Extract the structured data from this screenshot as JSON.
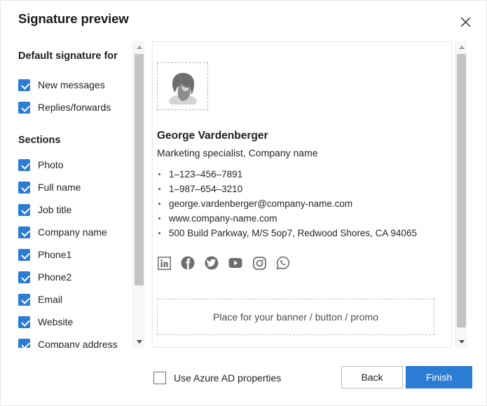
{
  "dialog": {
    "title": "Signature preview",
    "close_icon": "close-icon"
  },
  "sidebar": {
    "groups": [
      {
        "title": "Default signature for",
        "items": [
          {
            "label": "New messages",
            "checked": true
          },
          {
            "label": "Replies/forwards",
            "checked": true
          }
        ]
      },
      {
        "title": "Sections",
        "items": [
          {
            "label": "Photo",
            "checked": true
          },
          {
            "label": "Full name",
            "checked": true
          },
          {
            "label": "Job title",
            "checked": true
          },
          {
            "label": "Company name",
            "checked": true
          },
          {
            "label": "Phone1",
            "checked": true
          },
          {
            "label": "Phone2",
            "checked": true
          },
          {
            "label": "Email",
            "checked": true
          },
          {
            "label": "Website",
            "checked": true
          },
          {
            "label": "Company address",
            "checked": true
          }
        ]
      }
    ],
    "scrollbar": {
      "up_icon": "chevron-up-icon",
      "down_icon": "chevron-down-icon"
    }
  },
  "preview": {
    "photo": {
      "icon": "avatar-person-icon"
    },
    "name": "George Vardenberger",
    "role": "Marketing specialist, Company name",
    "contacts": [
      "1–123–456–7891",
      "1–987–654–3210",
      "george.vardenberger@company-name.com",
      "www.company-name.com",
      "500 Build Parkway, M/S 5op7, Redwood Shores, CA 94065"
    ],
    "social": [
      {
        "name": "linkedin-icon",
        "label": "LinkedIn"
      },
      {
        "name": "facebook-icon",
        "label": "Facebook"
      },
      {
        "name": "twitter-icon",
        "label": "Twitter"
      },
      {
        "name": "youtube-icon",
        "label": "YouTube"
      },
      {
        "name": "instagram-icon",
        "label": "Instagram"
      },
      {
        "name": "whatsapp-icon",
        "label": "WhatsApp"
      }
    ],
    "banner_text": "Place for your banner / button / promo",
    "scrollbar": {
      "up_icon": "chevron-up-icon",
      "down_icon": "chevron-down-icon"
    }
  },
  "footer": {
    "azure_checkbox": {
      "label": "Use Azure AD properties",
      "checked": false
    },
    "back_label": "Back",
    "finish_label": "Finish"
  },
  "colors": {
    "accent": "#2b7cd3",
    "checkbox_checked": "#2b7cd3",
    "text": "#242424",
    "social_icon": "#6e6e6e",
    "scroll_thumb": "#c3c3c3",
    "dashed_border": "#b5b5b5"
  }
}
